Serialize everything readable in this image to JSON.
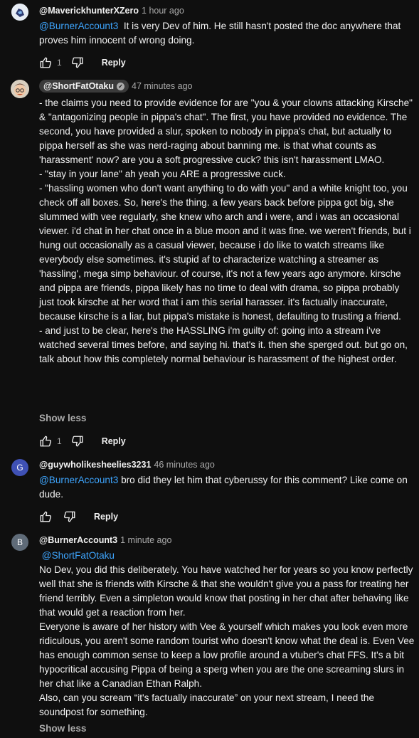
{
  "comments": [
    {
      "author": "@MaverickhunterXZero",
      "time": "1 hour ago",
      "mention": "@BurnerAccount3",
      "lines": [
        "It is very Dev of him. He still hasn't posted the doc anywhere that proves him innocent of wrong doing."
      ],
      "likes": "1",
      "reply_label": "Reply"
    },
    {
      "author": "@ShortFatOtaku",
      "time": "47 minutes ago",
      "lines": [
        "- the claims you need to provide evidence for are \"you & your clowns attacking Kirsche\" & \"antagonizing people in pippa's chat\". The first, you have provided no evidence. The second, you have provided a slur, spoken to nobody in pippa's chat, but actually to pippa herself as she was nerd-raging about banning me. is that what counts as 'harassment' now? are you a soft progressive cuck? this isn't harassment LMAO.",
        "- \"stay in your lane\" ah yeah you ARE a progressive cuck.",
        "- \"hassling women who don't want anything to do with you\" and a white knight too, you check off all boxes. So, here's the thing. a few years back before pippa got big, she slummed with vee regularly, she knew who arch and i were, and i was an occasional viewer. i'd chat in her chat once in a blue moon and it was fine. we weren't friends, but i hung out occasionally as a casual viewer, because i do like to watch streams like everybody else sometimes. it's stupid af to characterize watching a streamer as 'hassling', mega simp behaviour. of course, it's not a few years ago anymore. kirsche and pippa are friends, pippa likely has no time to deal with drama, so pippa probably just took kirsche at her word that i am this serial harasser. it's factually inaccurate, because kirsche is a liar, but pippa's mistake is honest, defaulting to trusting a friend.",
        "- and just to be clear, here's the HASSLING i'm guilty of: going into a stream i've watched several times before, and saying hi. that's it. then she sperged out. but go on, talk about how this completely normal behaviour is harassment of the highest order."
      ],
      "show_less": "Show less",
      "likes": "1",
      "reply_label": "Reply"
    },
    {
      "author": "@guywholikesheelies3231",
      "time": "46 minutes ago",
      "avatar_letter": "G",
      "mention": "@BurnerAccount3",
      "lines": [
        "bro did they let him that cyberussy for this comment? Like come on dude."
      ],
      "reply_label": "Reply"
    },
    {
      "author": "@BurnerAccount3",
      "time": "1 minute ago",
      "avatar_letter": "B",
      "mention": "@ShortFatOtaku",
      "lines": [
        "No Dev, you did this deliberately. You have watched her for years so you know perfectly well that she is friends with Kirsche & that she wouldn't give you a pass for treating her friend terribly. Even a simpleton would know that posting in her chat after behaving like that would get a reaction from her.",
        "Everyone is aware of her history with Vee & yourself which makes you look even more ridiculous, you aren't some random tourist who doesn't know what the deal is. Even Vee has enough common sense to keep a low profile around a vtuber's chat FFS. It's a bit hypocritical accusing Pippa of being a sperg when you are the one screaming slurs in her chat like a Canadian Ethan Ralph.",
        "Also, can you scream “it's factually inaccurate” on your next stream, I need the soundpost for something."
      ],
      "show_less": "Show less"
    }
  ],
  "colors": {
    "background": "#0f0f0f",
    "text": "#f1f1f1",
    "muted": "#aaaaaa",
    "link": "#3ea6ff",
    "avatar_g": "#3f51b5",
    "avatar_b": "#5f6b78"
  }
}
